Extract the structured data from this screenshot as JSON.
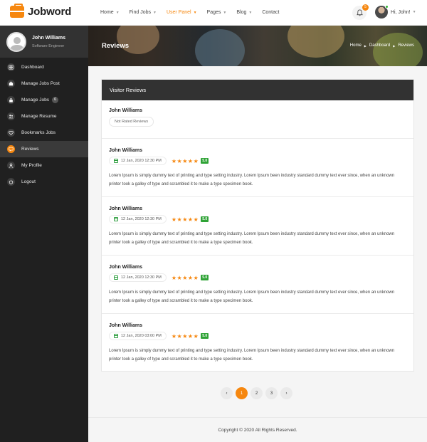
{
  "brand": {
    "name": "Jobword",
    "accent": "#f6870f"
  },
  "nav": {
    "items": [
      {
        "label": "Home",
        "caret": true
      },
      {
        "label": "Find Jobs",
        "caret": true
      },
      {
        "label": "User Panel",
        "caret": true
      },
      {
        "label": "Pages",
        "caret": true
      },
      {
        "label": "Blog",
        "caret": true
      },
      {
        "label": "Contact",
        "caret": false
      }
    ],
    "active": "User Panel",
    "notification_count": "5",
    "greeting": "Hi, John!"
  },
  "sidebar": {
    "profile": {
      "name": "John Williams",
      "role": "Software Engineer"
    },
    "items": [
      {
        "label": "Dashboard",
        "icon": "dashboard-icon"
      },
      {
        "label": "Manage Jobs Post",
        "icon": "briefcase-icon"
      },
      {
        "label": "Manage Jobs",
        "icon": "lock-icon",
        "badge": "6"
      },
      {
        "label": "Manage Resume",
        "icon": "users-icon"
      },
      {
        "label": "Bookmarks Jobs",
        "icon": "heart-icon"
      },
      {
        "label": "Reviews",
        "icon": "chat-icon",
        "active": true
      },
      {
        "label": "My Profile",
        "icon": "user-icon"
      },
      {
        "label": "Logout",
        "icon": "power-icon"
      }
    ]
  },
  "banner": {
    "title": "Reviews",
    "breadcrumb": [
      "Home",
      "Dashboard",
      "Reviews"
    ]
  },
  "reviews_panel": {
    "title": "Visitor Reviews",
    "first_review": {
      "name": "John Williams",
      "status": "Not Rated Reviews"
    },
    "reviews": [
      {
        "name": "John Williams",
        "date": "12 Jan, 2020 12:30 PM",
        "stars": 5,
        "rating": "5.0",
        "text": "Lorem Ipsum is simply dummy text of printing and type setting industry. Lorem Ipsum been industry standard dummy text ever since, when an unknown printer took a galley of type and scrambled it to make a type specimen book."
      },
      {
        "name": "John Williams",
        "date": "12 Jan, 2020 12:30 PM",
        "stars": 5,
        "rating": "5.0",
        "text": "Lorem Ipsum is simply dummy text of printing and type setting industry. Lorem Ipsum been industry standard dummy text ever since, when an unknown printer took a galley of type and scrambled it to make a type specimen book."
      },
      {
        "name": "John Williams",
        "date": "12 Jan, 2020 12:30 PM",
        "stars": 5,
        "rating": "5.0",
        "text": "Lorem Ipsum is simply dummy text of printing and type setting industry. Lorem Ipsum been industry standard dummy text ever since, when an unknown printer took a galley of type and scrambled it to make a type specimen book."
      },
      {
        "name": "John Williams",
        "date": "12 Jan, 2020 03:00 PM",
        "stars": 5,
        "rating": "5.0",
        "text": "Lorem Ipsum is simply dummy text of printing and type setting industry. Lorem Ipsum been industry standard dummy text ever since, when an unknown printer took a galley of type and scrambled it to make a type specimen book."
      }
    ]
  },
  "pagination": {
    "prev": "‹",
    "pages": [
      "1",
      "2",
      "3"
    ],
    "active": "1",
    "next": "›"
  },
  "footer": {
    "text": "Copyright © 2020 All Rights Reserved."
  }
}
